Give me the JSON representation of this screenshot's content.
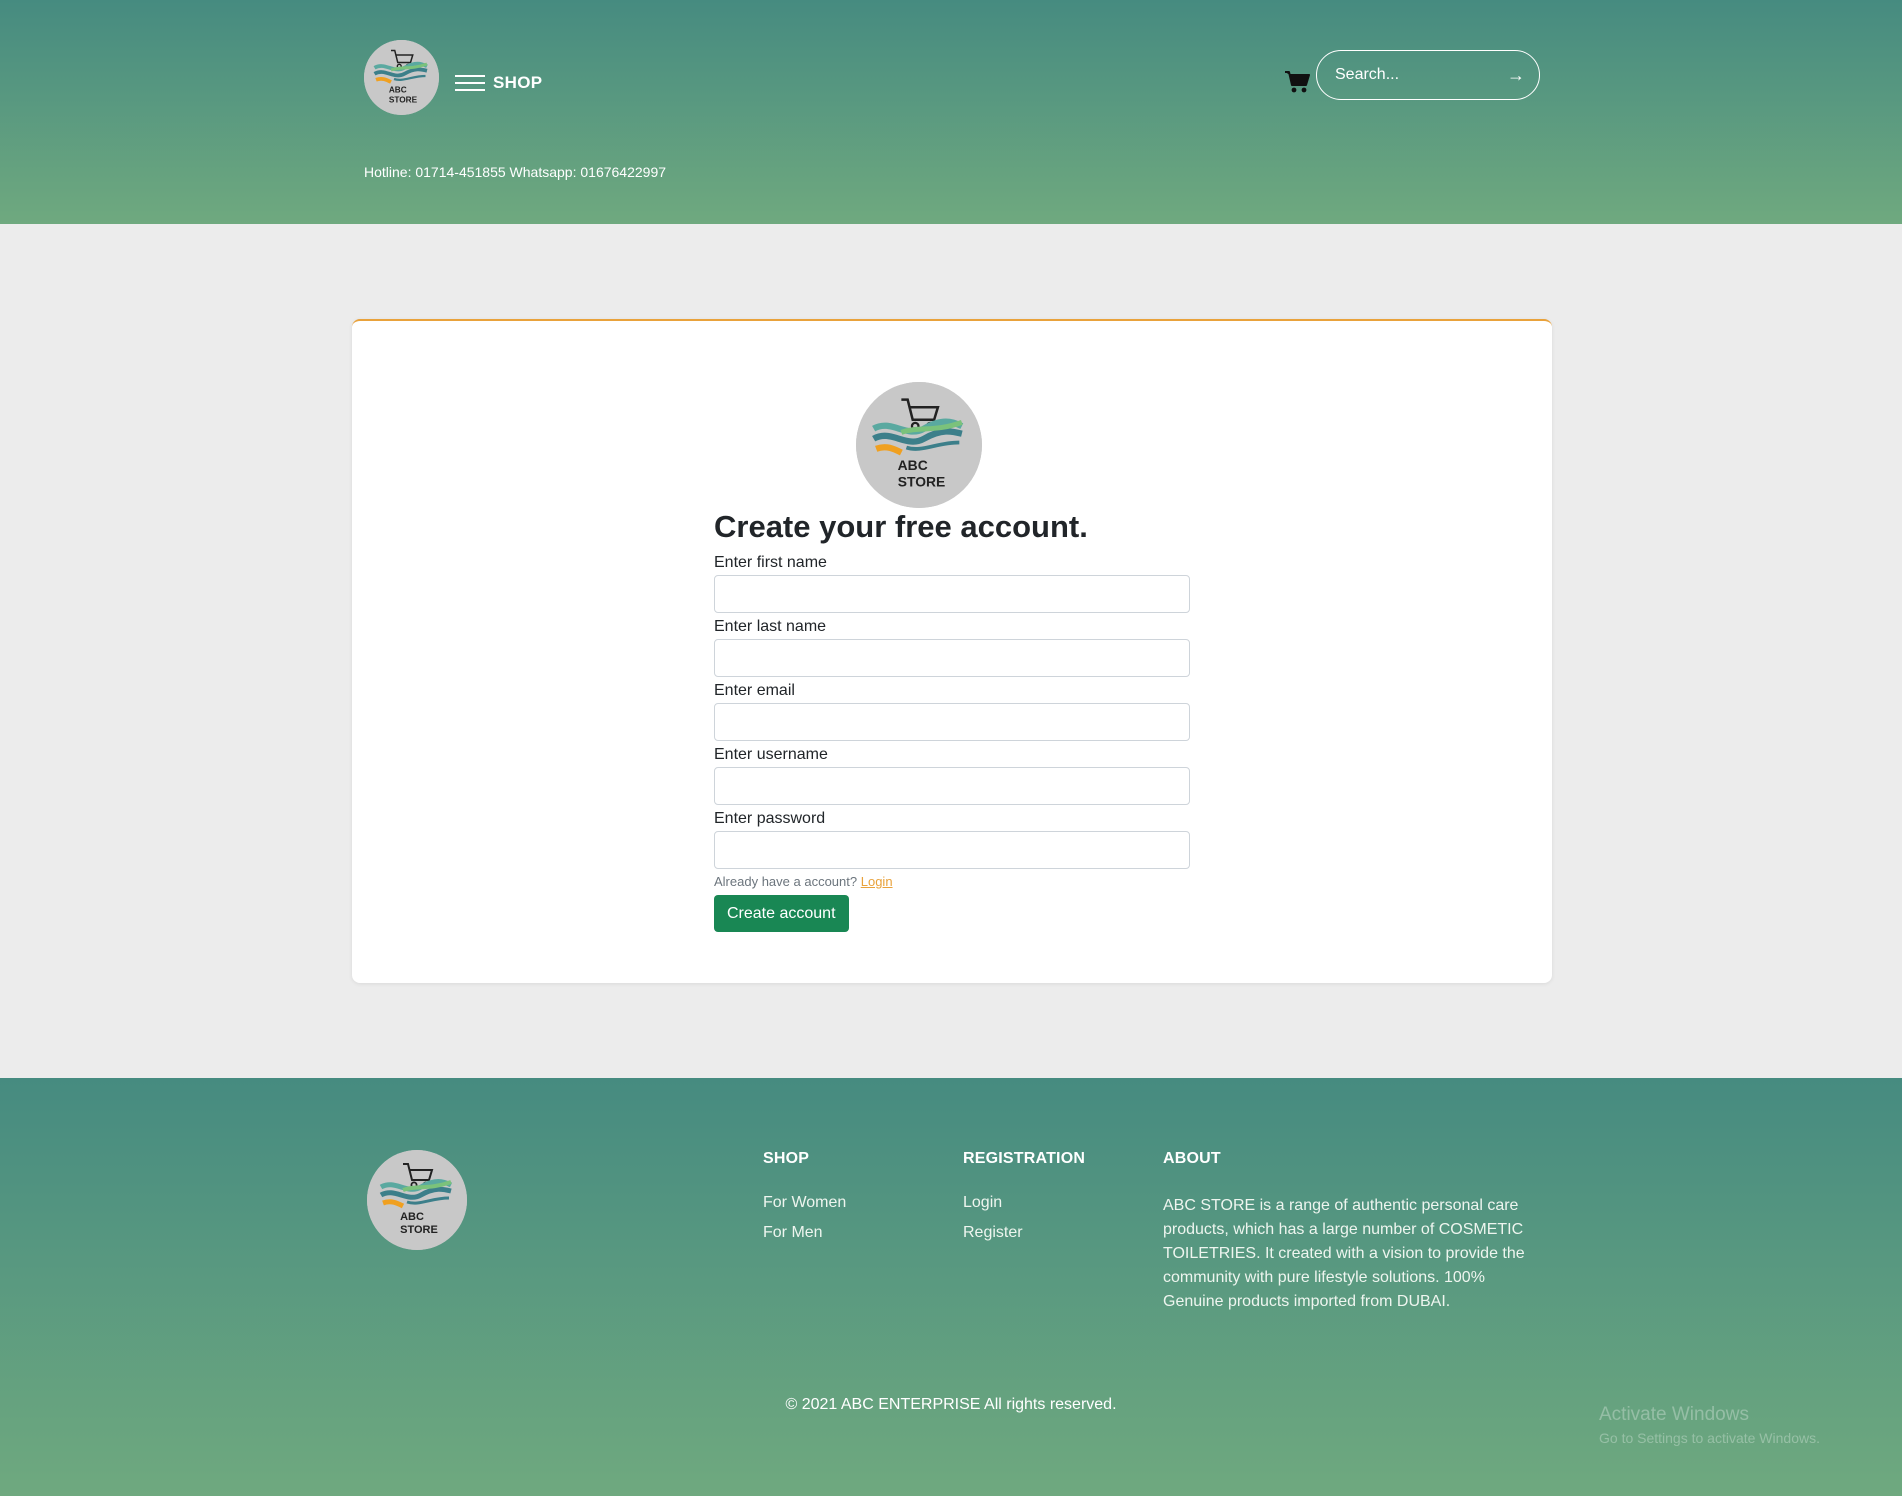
{
  "header": {
    "logo_text": "ABC STORE",
    "menu_label": "SHOP",
    "hotline": "Hotline: 01714-451855 Whatsapp: 01676422997",
    "search_placeholder": "Search...",
    "search_button": "→"
  },
  "form": {
    "title": "Create your free account.",
    "first_name_label": "Enter first name",
    "last_name_label": "Enter last name",
    "email_label": "Enter email",
    "username_label": "Enter username",
    "password_label": "Enter password",
    "already_text": "Already have a account?",
    "login_link": "Login",
    "submit_label": "Create account"
  },
  "footer": {
    "shop": {
      "heading": "SHOP",
      "links": [
        "For Women",
        "For Men"
      ]
    },
    "registration": {
      "heading": "REGISTRATION",
      "links": [
        "Login",
        "Register"
      ]
    },
    "about": {
      "heading": "ABOUT",
      "text": "ABC STORE is a range of authentic personal care products, which has a large number of COSMETIC TOILETRIES. It created with a vision to provide the community with pure lifestyle solutions. 100% Genuine products imported from DUBAI."
    },
    "copyright": "© 2021 ABC ENTERPRISE All rights reserved."
  },
  "os_overlay": {
    "title": "Activate Windows",
    "subtitle": "Go to Settings to activate Windows."
  },
  "colors": {
    "header_top": "#468b80",
    "header_bottom": "#6fa97f",
    "accent_orange": "#e9a23b",
    "button_green": "#198754",
    "page_bg": "#ececec"
  },
  "icons": [
    "logo-icon",
    "menu-icon",
    "cart-icon",
    "arrow-right-icon"
  ]
}
